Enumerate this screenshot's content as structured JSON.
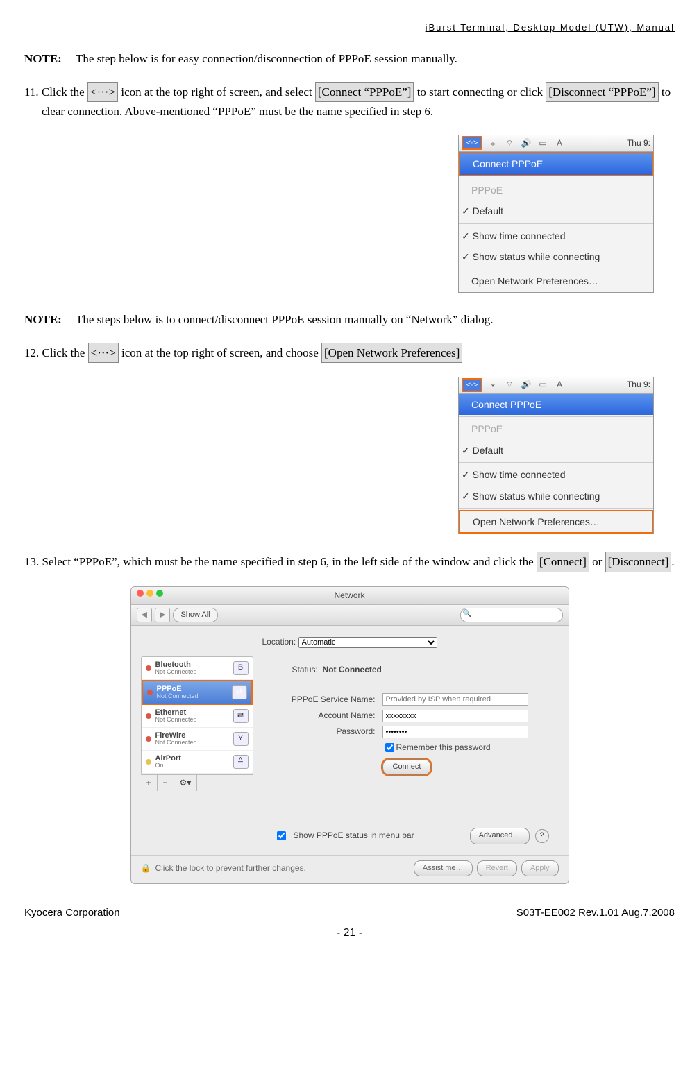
{
  "header": {
    "manual_title": "iBurst  Terminal,  Desktop  Model  (UTW),  Manual"
  },
  "note1": {
    "label": "NOTE:",
    "text": "The step below is for easy connection/disconnection of PPPoE session manually."
  },
  "step11": {
    "number": "11.",
    "pre": "Click the ",
    "icon_txt": "<···>",
    "mid1": " icon at the top right of screen, and select ",
    "btn1": "[Connect “PPPoE”]",
    "mid2": " to start connecting or click ",
    "btn2": "[Disconnect “PPPoE”]",
    "post": " to clear connection. Above-mentioned “PPPoE” must be the name specified in step 6."
  },
  "menubar": {
    "icon_ppoe": "<·>",
    "time": "Thu 9:",
    "connect": "Connect PPPoE",
    "pppoe": "PPPoE",
    "default": "Default",
    "show_time": "Show time connected",
    "show_status": "Show status while connecting",
    "open_pref": "Open Network Preferences…"
  },
  "note2": {
    "label": "NOTE:",
    "text": "The steps below is to connect/disconnect PPPoE session manually on “Network” dialog."
  },
  "step12": {
    "number": "12.",
    "pre": "Click the ",
    "icon_txt": "<···>",
    "mid": " icon at the top right of screen, and choose ",
    "btn": "[Open Network Preferences]"
  },
  "step13": {
    "number": "13.",
    "pre": "Select “PPPoE”, which must be the name specified in step 6, in the left side of the window and click the ",
    "btn1": "[Connect]",
    "mid": " or ",
    "btn2": "[Disconnect]",
    "post": "."
  },
  "netwin": {
    "title": "Network",
    "show_all": "Show All",
    "location_label": "Location:",
    "location_value": "Automatic",
    "status_label": "Status:",
    "status_value": "Not Connected",
    "pppoe_service_label": "PPPoE Service Name:",
    "pppoe_service_ph": "Provided by ISP when required",
    "account_label": "Account Name:",
    "account_value": "xxxxxxxx",
    "password_label": "Password:",
    "password_value": "••••••••",
    "remember": "Remember this password",
    "connect": "Connect",
    "show_status_menu": "Show PPPoE status in menu bar",
    "advanced": "Advanced…",
    "lock_text": "Click the lock to prevent further changes.",
    "assist": "Assist me…",
    "revert": "Revert",
    "apply": "Apply",
    "sidebar": [
      {
        "name": "Bluetooth",
        "sub": "Not Connected",
        "ico": "B",
        "dot": "red"
      },
      {
        "name": "PPPoE",
        "sub": "Not Connected",
        "ico": "⇄",
        "dot": "red",
        "sel": true
      },
      {
        "name": "Ethernet",
        "sub": "Not Connected",
        "ico": "⇄",
        "dot": "red"
      },
      {
        "name": "FireWire",
        "sub": "Not Connected",
        "ico": "Y",
        "dot": "red"
      },
      {
        "name": "AirPort",
        "sub": "On",
        "ico": "≙",
        "dot": "yel"
      }
    ]
  },
  "footer": {
    "left": "Kyocera Corporation",
    "right": "S03T-EE002 Rev.1.01 Aug.7.2008",
    "page": "- 21 -"
  }
}
